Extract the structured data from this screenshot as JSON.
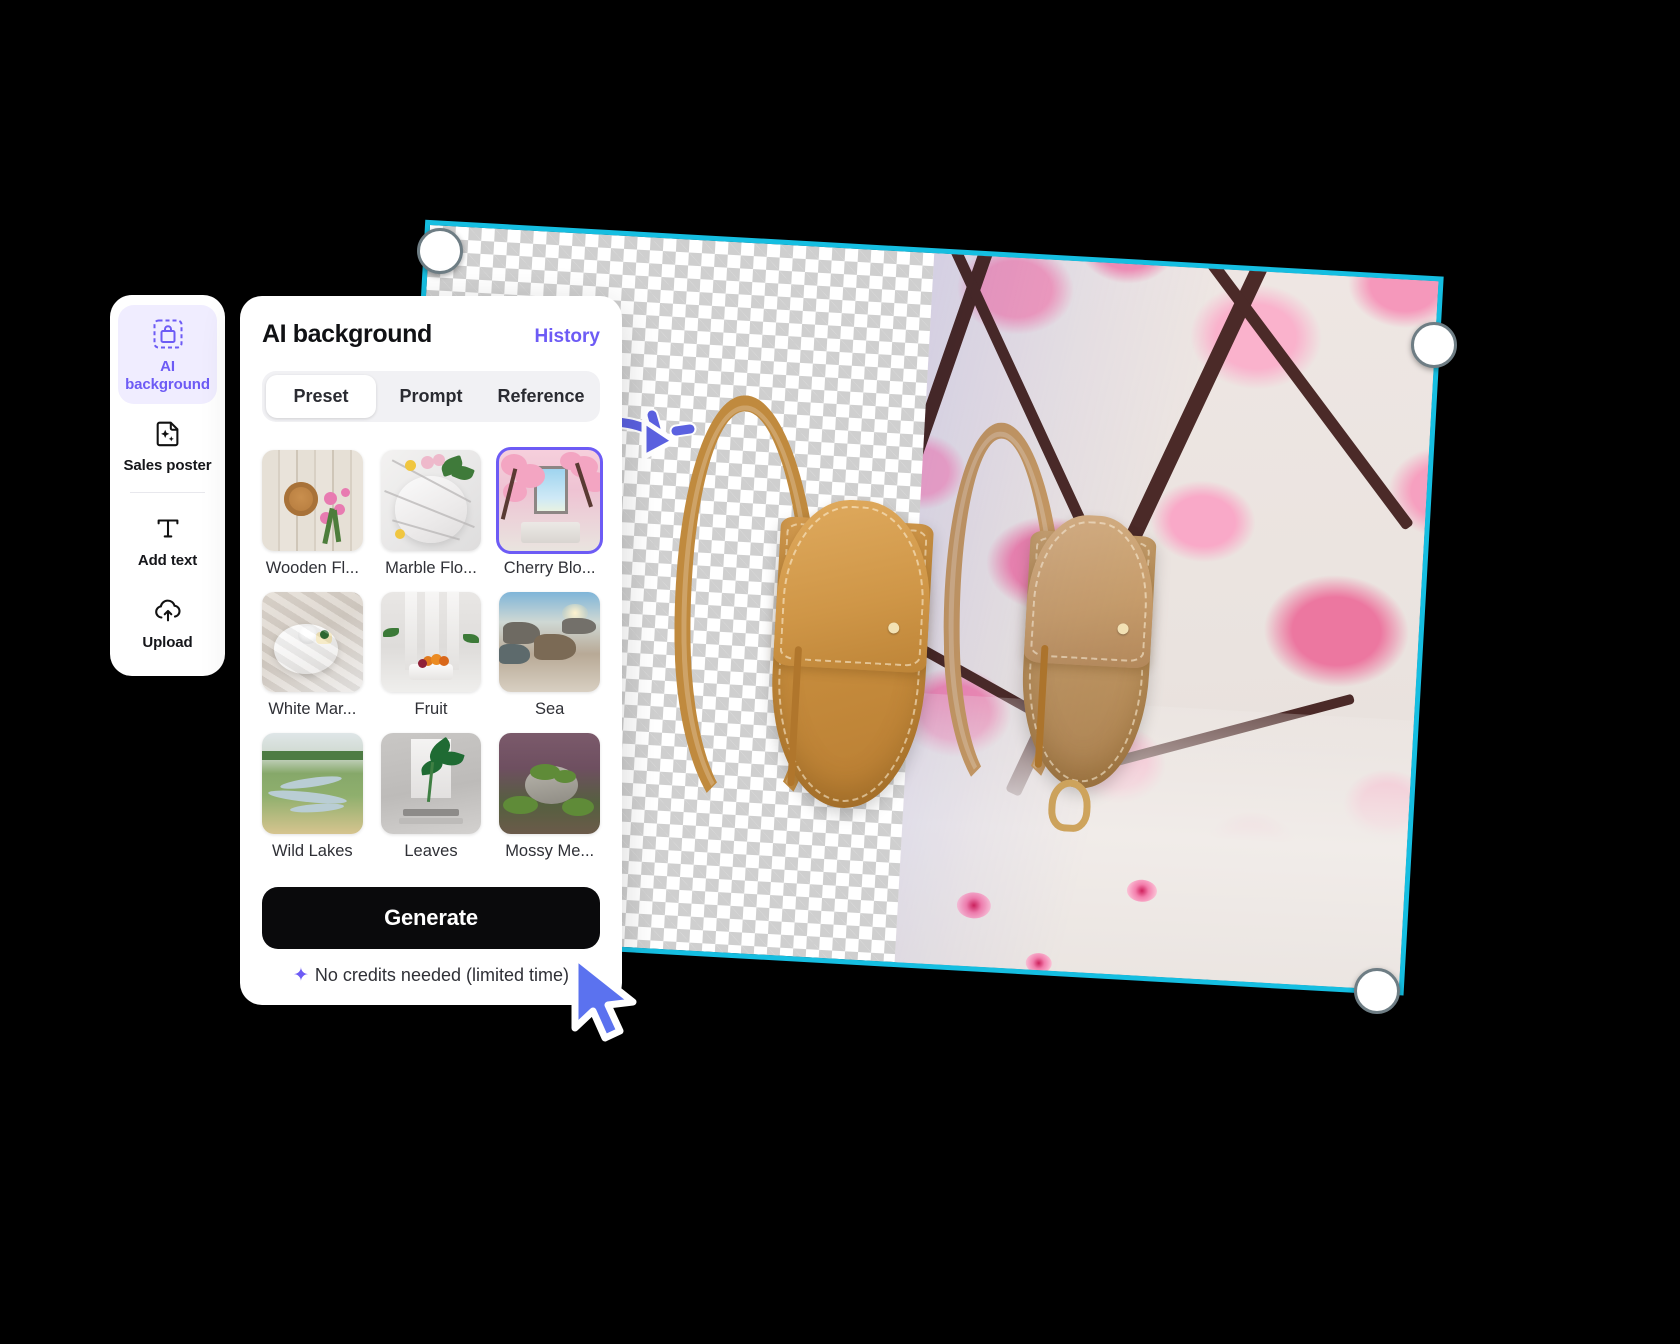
{
  "app": {
    "accent_purple": "#6d5bf5",
    "selection_cyan": "#15bee1",
    "panel_bg": "#ffffff",
    "button_black": "#0a0a0c"
  },
  "tool_rail": {
    "items": [
      {
        "label": "AI\nbackground",
        "label_line1": "AI",
        "label_line2": "background",
        "icon": "ai-bag-icon",
        "active": true
      },
      {
        "label": "Sales poster",
        "icon": "sparkle-document-icon",
        "active": false
      },
      {
        "label": "Add text",
        "icon": "text-t-icon",
        "active": false
      },
      {
        "label": "Upload",
        "icon": "cloud-upload-icon",
        "active": false
      }
    ]
  },
  "panel": {
    "title": "AI background",
    "history_label": "History",
    "tabs": [
      {
        "label": "Preset",
        "active": true
      },
      {
        "label": "Prompt",
        "active": false
      },
      {
        "label": "Reference",
        "active": false
      }
    ],
    "presets": [
      {
        "label": "Wooden Fl...",
        "art": "t-wood",
        "selected": false
      },
      {
        "label": "Marble Flo...",
        "art": "t-marble",
        "selected": false
      },
      {
        "label": "Cherry Blo...",
        "art": "t-cherry",
        "selected": true
      },
      {
        "label": "White Mar...",
        "art": "t-white",
        "selected": false
      },
      {
        "label": "Fruit",
        "art": "t-fruit",
        "selected": false
      },
      {
        "label": "Sea",
        "art": "t-sea",
        "selected": false
      },
      {
        "label": "Wild Lakes",
        "art": "t-lakes",
        "selected": false
      },
      {
        "label": "Leaves",
        "art": "t-leaves",
        "selected": false
      },
      {
        "label": "Mossy Me...",
        "art": "t-moss",
        "selected": false
      }
    ],
    "generate_label": "Generate",
    "credits_icon": "sparkle-icon",
    "credits_note": "No credits needed (limited time)"
  },
  "canvas": {
    "selection_border_color": "#15bee1",
    "handles": 4,
    "left_half": "transparent-checkerboard-with-handbag",
    "right_half": "cherry-blossom-background-preview",
    "annotation": "curved-arrow-pointing-right",
    "cursor": "pointer-cursor"
  }
}
